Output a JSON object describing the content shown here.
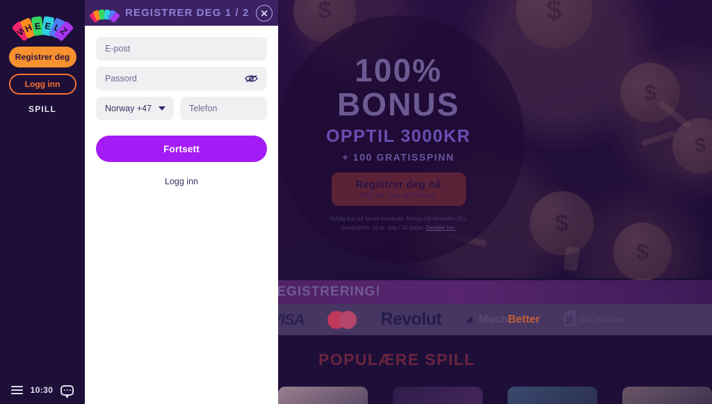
{
  "sidebar": {
    "logo_letters": [
      "W",
      "H",
      "E",
      "E",
      "L",
      "Z"
    ],
    "register_label": "Registrer deg",
    "login_label": "Logg inn",
    "nav_spill": "SPILL",
    "clock": "10:30"
  },
  "modal": {
    "title": "REGISTRER DEG 1 / 2",
    "email_placeholder": "E-post",
    "email_value": "",
    "password_placeholder": "Passord",
    "password_value": "",
    "country_selected": "Norway +47",
    "phone_placeholder": "Telefon",
    "phone_value": "",
    "continue_label": "Fortsett",
    "login_link": "Logg inn"
  },
  "promo": {
    "headline_percent": "100%",
    "headline_bonus": "BONUS",
    "upto": "OPPTIL 3000KR",
    "free_spins": "+ 100 GRATISSPINN",
    "cta_main": "Registrer deg nå",
    "cta_sub": "Det tar kun ett minutt",
    "terms": "Gyldig kun på første innskudd. Bonus må omsettes 35x. Gratisspinn: 10 pr. dag i 10 dager. ",
    "terms_link": "Detaljer her."
  },
  "strip": {
    "text": "INNSKUDDSFRIE GRATISSPINN VED REGISTRERING!"
  },
  "payments": {
    "visa": "VISA",
    "mastercard": "mastercard",
    "revolut": "Revolut",
    "muchbetter_much": "Much",
    "muchbetter_better": "Better",
    "ssl": "SSL SECURE"
  },
  "popular": {
    "title": "POPULÆRE SPILL"
  },
  "colors": {
    "brand_purple": "#a41cf5",
    "brand_orange": "#f7912f",
    "modal_header": "#3c2263",
    "page_bg": "#1e0f38"
  }
}
